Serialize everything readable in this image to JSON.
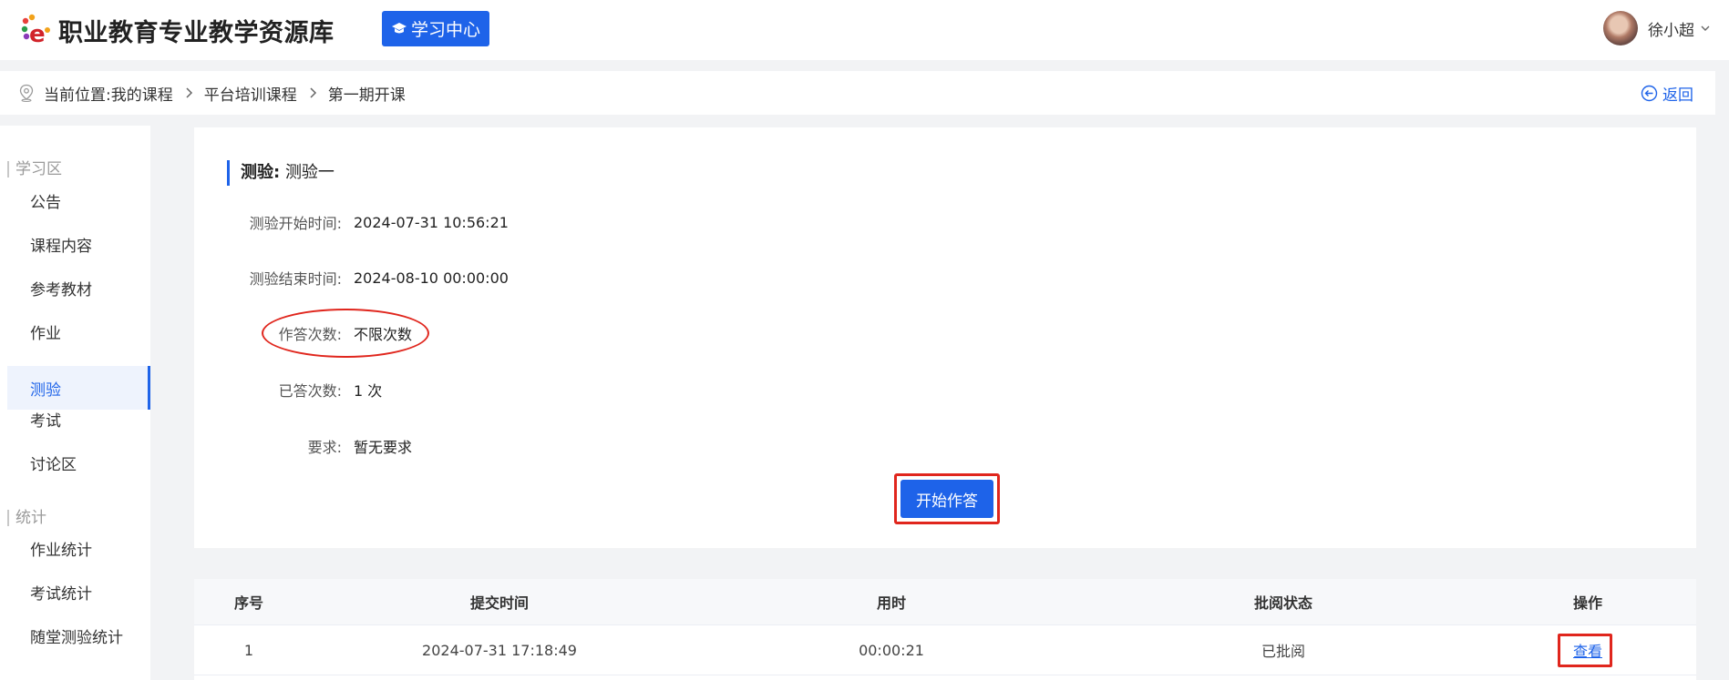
{
  "header": {
    "site_title": "职业教育专业教学资源库",
    "learn_center_label": "学习中心",
    "user_name": "徐小超"
  },
  "breadcrumb": {
    "prefix": "当前位置:",
    "items": [
      "我的课程",
      "平台培训课程",
      "第一期开课"
    ],
    "back_label": "返回"
  },
  "sidebar": {
    "sections": [
      {
        "title": "学习区",
        "items": [
          {
            "label": "公告",
            "active": false
          },
          {
            "label": "课程内容",
            "active": false
          },
          {
            "label": "参考教材",
            "active": false
          },
          {
            "label": "作业",
            "active": false
          },
          {
            "label": "测验",
            "active": true
          },
          {
            "label": "考试",
            "active": false
          },
          {
            "label": "讨论区",
            "active": false
          }
        ]
      },
      {
        "title": "统计",
        "items": [
          {
            "label": "作业统计",
            "active": false
          },
          {
            "label": "考试统计",
            "active": false
          },
          {
            "label": "随堂测验统计",
            "active": false
          }
        ]
      }
    ]
  },
  "quiz": {
    "title_prefix": "测验:",
    "title_name": "测验一",
    "fields": [
      {
        "label": "测验开始时间:",
        "value": "2024-07-31 10:56:21"
      },
      {
        "label": "测验结束时间:",
        "value": "2024-08-10 00:00:00"
      },
      {
        "label": "作答次数:",
        "value": "不限次数"
      },
      {
        "label": "已答次数:",
        "value": "1 次"
      },
      {
        "label": "要求:",
        "value": "暂无要求"
      }
    ],
    "start_label": "开始作答"
  },
  "records": {
    "columns": [
      "序号",
      "提交时间",
      "用时",
      "批阅状态",
      "操作"
    ],
    "rows": [
      {
        "index": "1",
        "submit_time": "2024-07-31 17:18:49",
        "duration": "00:00:21",
        "status": "已批阅",
        "action": "查看"
      }
    ]
  },
  "colors": {
    "primary": "#1e63e9",
    "highlight_red": "#e0261d"
  }
}
